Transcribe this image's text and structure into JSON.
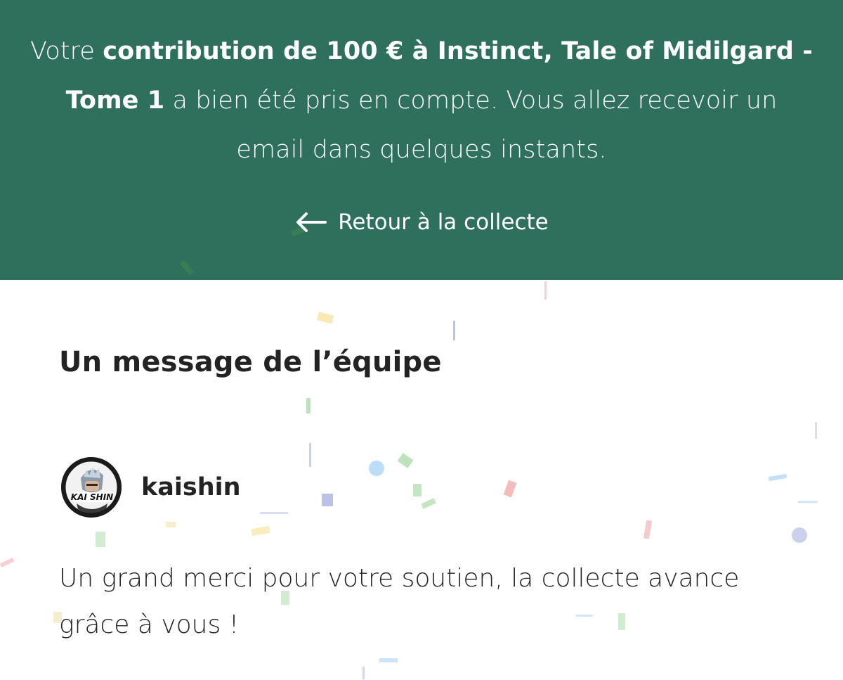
{
  "banner": {
    "intro": "Votre ",
    "contribution_strong": "contribution de 100 € à Instinct, Tale of Midilgard - Tome 1",
    "outro": " a bien été pris en compte. Vous allez recevoir un email dans quelques instants.",
    "back_label": "Retour à la collecte",
    "background_color": "#2f705c"
  },
  "message_section": {
    "title": "Un message de l’équipe",
    "author": {
      "name": "kaishin",
      "avatar_label": "KAI SHIN"
    },
    "body": "Un grand merci pour votre soutien, la collecte avance grâce à vous !"
  },
  "icons": {
    "back": "arrow-left-icon"
  }
}
